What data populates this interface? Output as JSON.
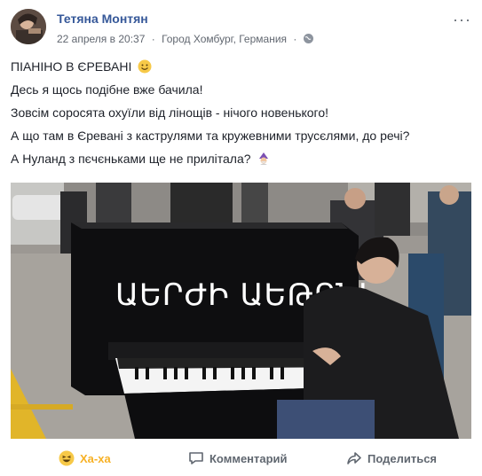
{
  "post": {
    "author": "Тетяна Монтян",
    "date": "22 апреля в 20:37",
    "location": "Город Хомбург, Германия",
    "dot": "·",
    "more_glyph": "···",
    "lines": [
      "ПІАНІНО В ЄРЕВАНІ",
      "Десь я щось подібне вже бачила!",
      "Зовсім соросята охуїли від лінощів - нічого новенького!",
      "А що там в Єревані з каструлями та кружевними трусєлями, до речі?",
      "А Нуланд з пєчєньками ще не прилітала?"
    ],
    "video": {
      "piano_lettering": "ԱԵՐԺԻ ԱԵԹՐՆԼ"
    }
  },
  "actions": {
    "reaction_label": "Ха-ха",
    "comment_label": "Комментарий",
    "share_label": "Поделиться"
  },
  "colors": {
    "author": "#365899",
    "meta": "#616770",
    "reaction": "#f7b125",
    "action": "#606770"
  },
  "icons": [
    "globe-icon",
    "smile-emoji-icon",
    "mage-emoji-icon",
    "haha-icon",
    "comment-icon",
    "share-icon",
    "more-icon"
  ]
}
